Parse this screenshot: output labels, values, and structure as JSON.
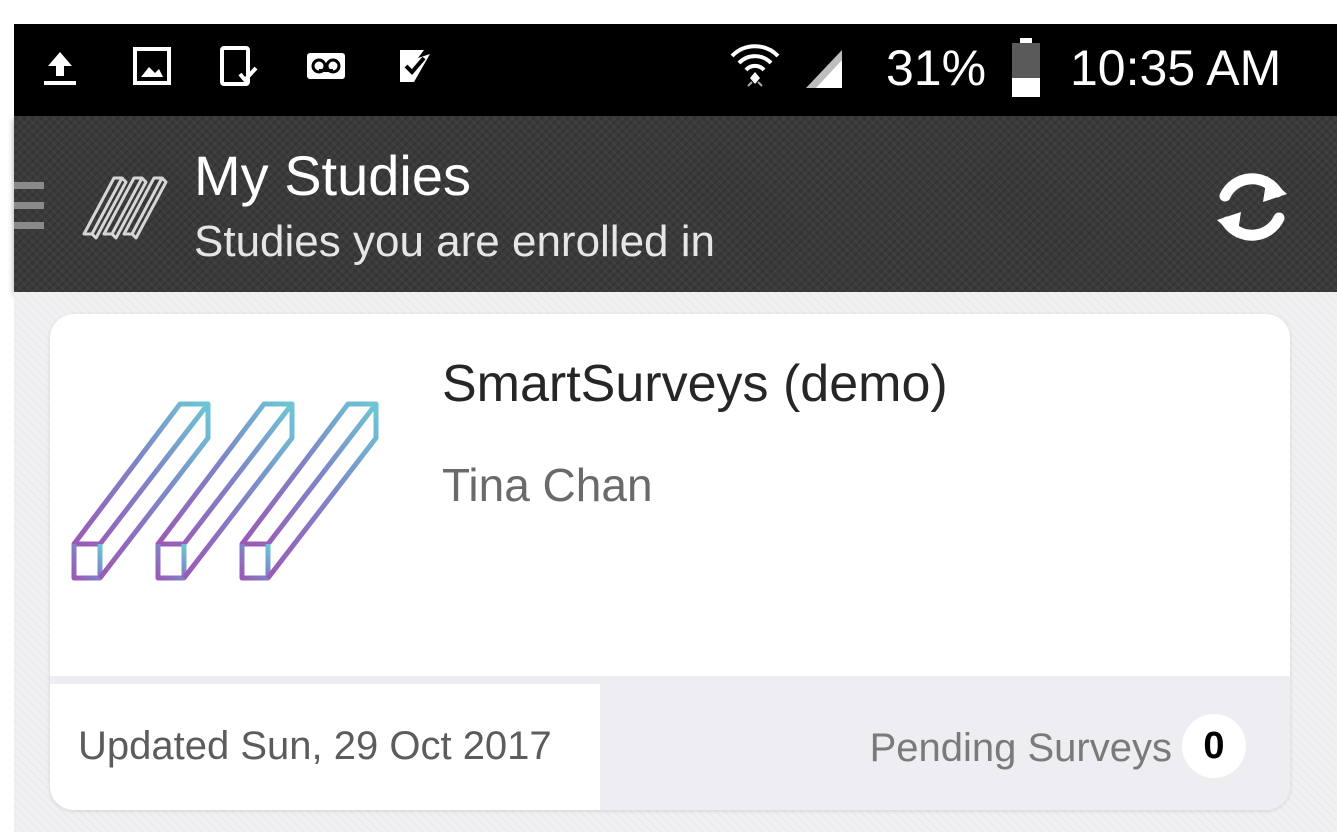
{
  "status_bar": {
    "battery": "31%",
    "time": "10:35 AM",
    "icons": [
      "upload-icon",
      "image-icon",
      "device-check-icon",
      "voicemail-icon",
      "task-icon",
      "wifi-icon",
      "signal-icon",
      "battery-icon"
    ]
  },
  "action_bar": {
    "title": "My Studies",
    "subtitle": "Studies you are enrolled in",
    "icons": [
      "menu-icon",
      "app-logo-icon",
      "refresh-icon"
    ]
  },
  "study_card": {
    "title": "SmartSurveys (demo)",
    "investigator": "Tina Chan",
    "updated": "Updated Sun, 29 Oct 2017",
    "pending_label": "Pending Surveys",
    "pending_count": "0"
  },
  "colors": {
    "status_bar_bg": "#000000",
    "action_bar_bg": "#3a3a3a",
    "content_bg": "#f1f1f3",
    "card_bg": "#ffffff",
    "footer_bg": "#ededf2",
    "logo_gradient_start": "#9b59b6",
    "logo_gradient_end": "#6cc6d4"
  }
}
